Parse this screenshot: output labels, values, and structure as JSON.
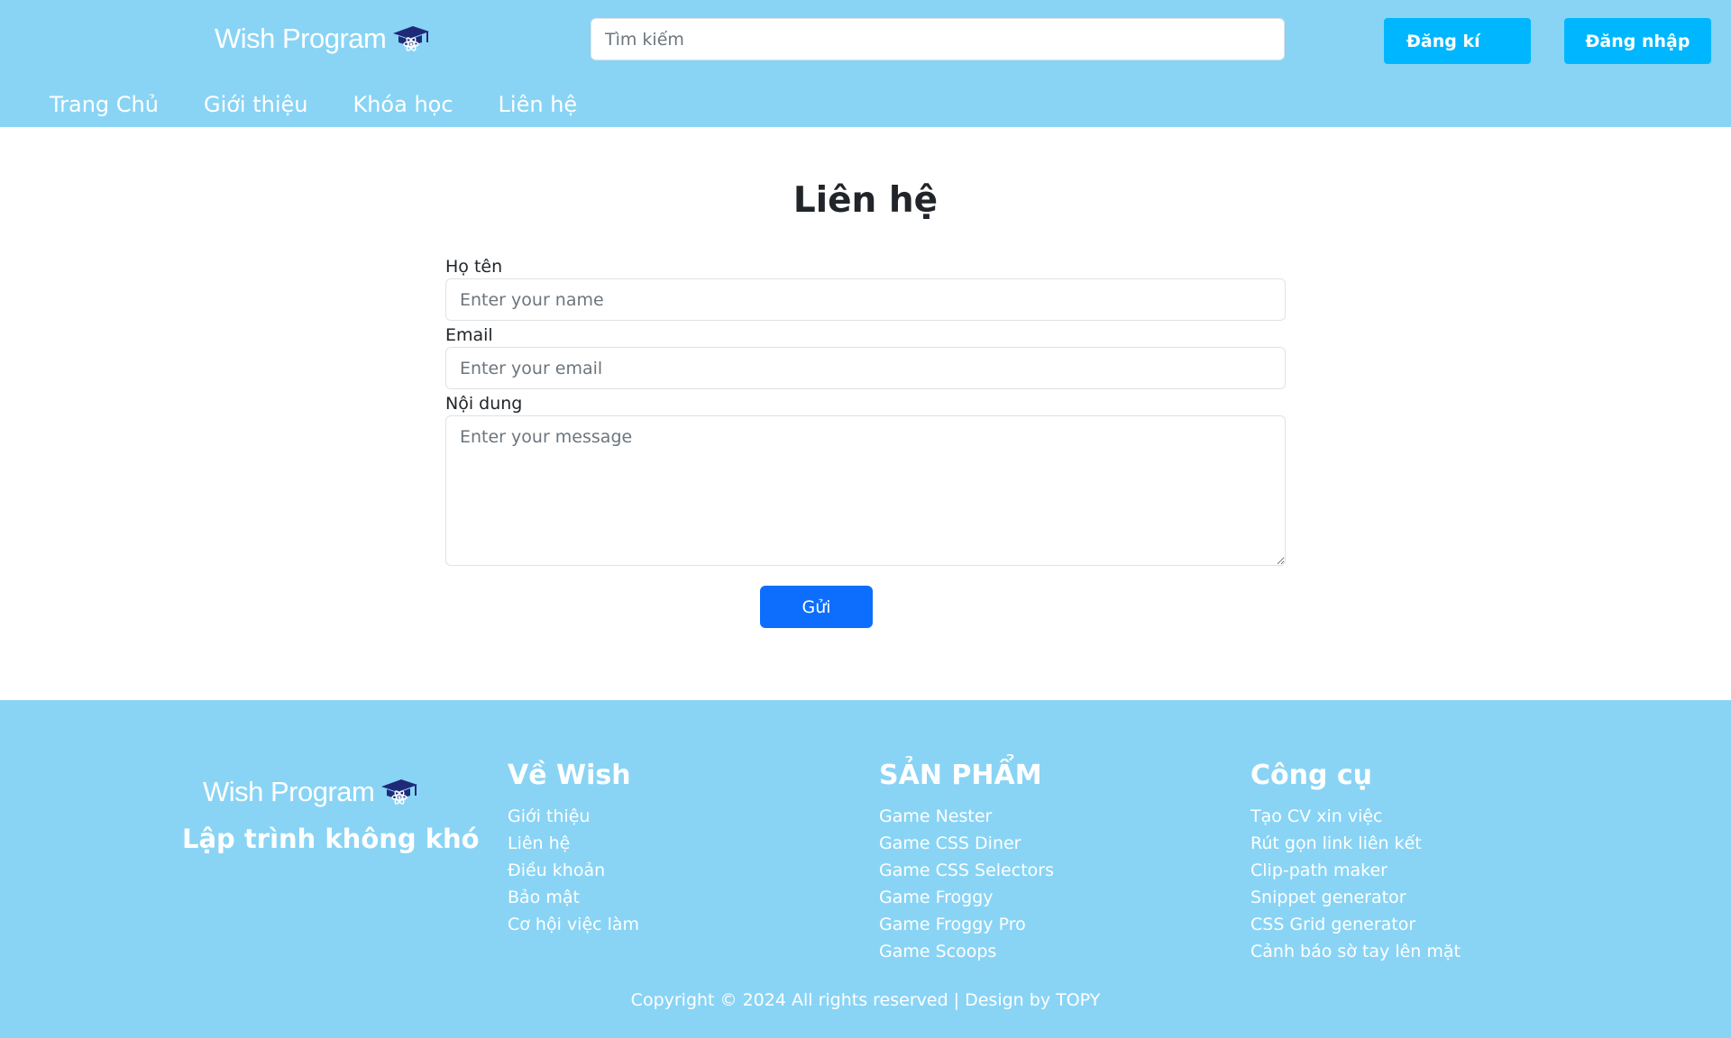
{
  "header": {
    "brand": "Wish Program",
    "search_placeholder": "Tìm kiếm",
    "register_label": "Đăng kí",
    "login_label": "Đăng nhập",
    "nav": [
      "Trang Chủ",
      "Giới thiệu",
      "Khóa học",
      "Liên hệ"
    ]
  },
  "main": {
    "title": "Liên hệ",
    "fields": {
      "name_label": "Họ tên",
      "name_placeholder": "Enter your name",
      "email_label": "Email",
      "email_placeholder": "Enter your email",
      "message_label": "Nội dung",
      "message_placeholder": "Enter your message"
    },
    "submit_label": "Gửi"
  },
  "footer": {
    "brand": "Wish Program",
    "slogan": "Lập trình không khó",
    "columns": [
      {
        "title": "Về Wish",
        "items": [
          "Giới thiệu",
          "Liên hệ",
          "Điều khoản",
          "Bảo mật",
          "Cơ hội việc làm"
        ]
      },
      {
        "title": "SẢN PHẨM",
        "items": [
          "Game Nester",
          "Game CSS Diner",
          "Game CSS Selectors",
          "Game Froggy",
          "Game Froggy Pro",
          "Game Scoops"
        ]
      },
      {
        "title": "Công cụ",
        "items": [
          "Tạo CV xin việc",
          "Rút gọn link liên kết",
          "Clip-path maker",
          "Snippet generator",
          "CSS Grid generator",
          "Cảnh báo sờ tay lên mặt"
        ]
      }
    ],
    "copyright": "Copyright © 2024 All rights reserved | Design by TOPY"
  },
  "colors": {
    "header_bg": "#89d4f5",
    "header_button": "#00b7ff",
    "submit_button": "#0d6efd",
    "logo_cap": "#1e2a78"
  },
  "icons": {
    "logo": "graduation-cap-atom-icon"
  }
}
